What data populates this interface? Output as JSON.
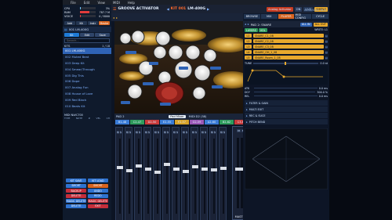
{
  "menubar": {
    "items": [
      "File",
      "Edit",
      "View",
      "MIDI",
      "Help"
    ]
  },
  "meters": [
    {
      "label": "CPU",
      "value": "3%",
      "fill": 0.03,
      "color": "#6ec6ff"
    },
    {
      "label": "RAM",
      "value": "787.7 M",
      "fill": 0.62,
      "color": "#e13b3b"
    },
    {
      "label": "VOICE",
      "value": "0 / 8000",
      "fill": 0.02,
      "color": "#e13b3b"
    }
  ],
  "left_panel": {
    "tabs": [
      "Add",
      "Kit",
      "Instr",
      "Master"
    ],
    "active_tab": "Master",
    "kit_header": "001 LM-400G",
    "kit_toolbar": [
      "Kit",
      "Edit",
      "Save"
    ],
    "search_placeholder": "Search...",
    "kits_label": "KITS",
    "kits_count": "1 / 18",
    "kits": [
      "001 LM-400G",
      "002 Muted Beat",
      "003 Deep Kit",
      "004 Smear/Through",
      "005 Dig This",
      "006 Dope",
      "007 Analog Fun",
      "008 House of Love",
      "009 Red Black",
      "010 Beats Kit"
    ],
    "selected_index": 0,
    "midi_section": "MIDI   NI#C700",
    "midi_cols": [
      "TYPE",
      "NOTE",
      "#",
      "VEL",
      "CH"
    ],
    "buttons_blue": [
      "KIT SAVE",
      "KIT LOAD",
      "SMORT",
      "UNDO",
      "REDO",
      "MAGIC DELETE",
      "BACKUP",
      "MAGIC DELETE",
      "DELETE",
      "DELETE"
    ],
    "buttons_red": [
      "SMORT",
      "BACKUP",
      "DELETE",
      "MAGIC DELETE",
      "EXIT"
    ]
  },
  "toolbar": {
    "title": "GROOVE ACTIVATOR",
    "kit_number": "KIT 001",
    "kit_name": "LM-400G",
    "chip1": "Analog Activator",
    "chip2": "ON",
    "mode_left": "LIVE",
    "mode_right": "SIMPLE",
    "tabs": [
      "BROWSE",
      "MIX",
      "PLAYER",
      "MIDI CONFIG",
      "CYCLE",
      "BUS"
    ],
    "active_tab": "MIX",
    "sub_tabs": [
      "ADVANCED",
      "BUS"
    ]
  },
  "scene": {
    "labels": [
      "Snare",
      "Kick",
      "Hi-Hat",
      "Open Hat",
      "Ride",
      "Crash",
      "Tom",
      "Clap"
    ]
  },
  "pads": {
    "pad_label": "PAD 2",
    "button_pad_mixer": "Pad Mixer",
    "midi_label": "MIDI D2 (38)",
    "bar_tabs": [
      {
        "label": "B1-48",
        "color": "#3a7bd5"
      },
      {
        "label": "C2-47",
        "color": "#2f9b5c"
      },
      {
        "label": "D2-50",
        "color": "#c93b3b"
      },
      {
        "label": "E2-55",
        "color": "#3a7bd5"
      },
      {
        "label": "F2-57",
        "color": "#d6a22a"
      },
      {
        "label": "G2-59",
        "color": "#9b59b6"
      },
      {
        "label": "A2-60",
        "color": "#3a7bd5"
      },
      {
        "label": "B2-62",
        "color": "#2f9b5c"
      },
      {
        "label": "C3-67",
        "color": "#c93b3b"
      }
    ]
  },
  "mixer": {
    "strip_labels": [
      "M",
      "S"
    ],
    "master_label": "MASTER",
    "channel_count": 12,
    "fader_levels": [
      0.62,
      0.58,
      0.64,
      0.6,
      0.55,
      0.66,
      0.6,
      0.57,
      0.63,
      0.6,
      0.59,
      0.61
    ]
  },
  "right_panel": {
    "title": "PAD 2: SNARE",
    "buttons_top": [
      "ALL IN",
      "ALL OUT"
    ],
    "layers_header": "LAYERS",
    "layers_sub": "VOL",
    "layer_write": "WRITE: L1",
    "layer_rows": [
      {
        "name": "SNARE_C1_08",
        "lvl": "L1",
        "color": "#e8a92d"
      },
      {
        "name": "SNARE_C2_08",
        "lvl": "L2",
        "color": "#e8a92d"
      },
      {
        "name": "SNARE_C3_08",
        "lvl": "L3",
        "color": "#e8a92d"
      },
      {
        "name": "SNARE_OH_1_08",
        "lvl": "L4",
        "color": "#e8a92d"
      },
      {
        "name": "SNARE_Room_1_08",
        "lvl": "L5",
        "color": "#e8a92d"
      }
    ],
    "tune_label": "TUNE",
    "tune_value": "0.0 st",
    "adsr": [
      {
        "label": "ATK",
        "value": "0.0 ms"
      },
      {
        "label": "DCY",
        "value": "300.0 %"
      },
      {
        "label": "REL",
        "value": "0.0 ms"
      }
    ],
    "sections": [
      "FILTER & GAIN",
      "MULTI EXIT",
      "REC & SUCE",
      "PITCH BEND"
    ]
  }
}
